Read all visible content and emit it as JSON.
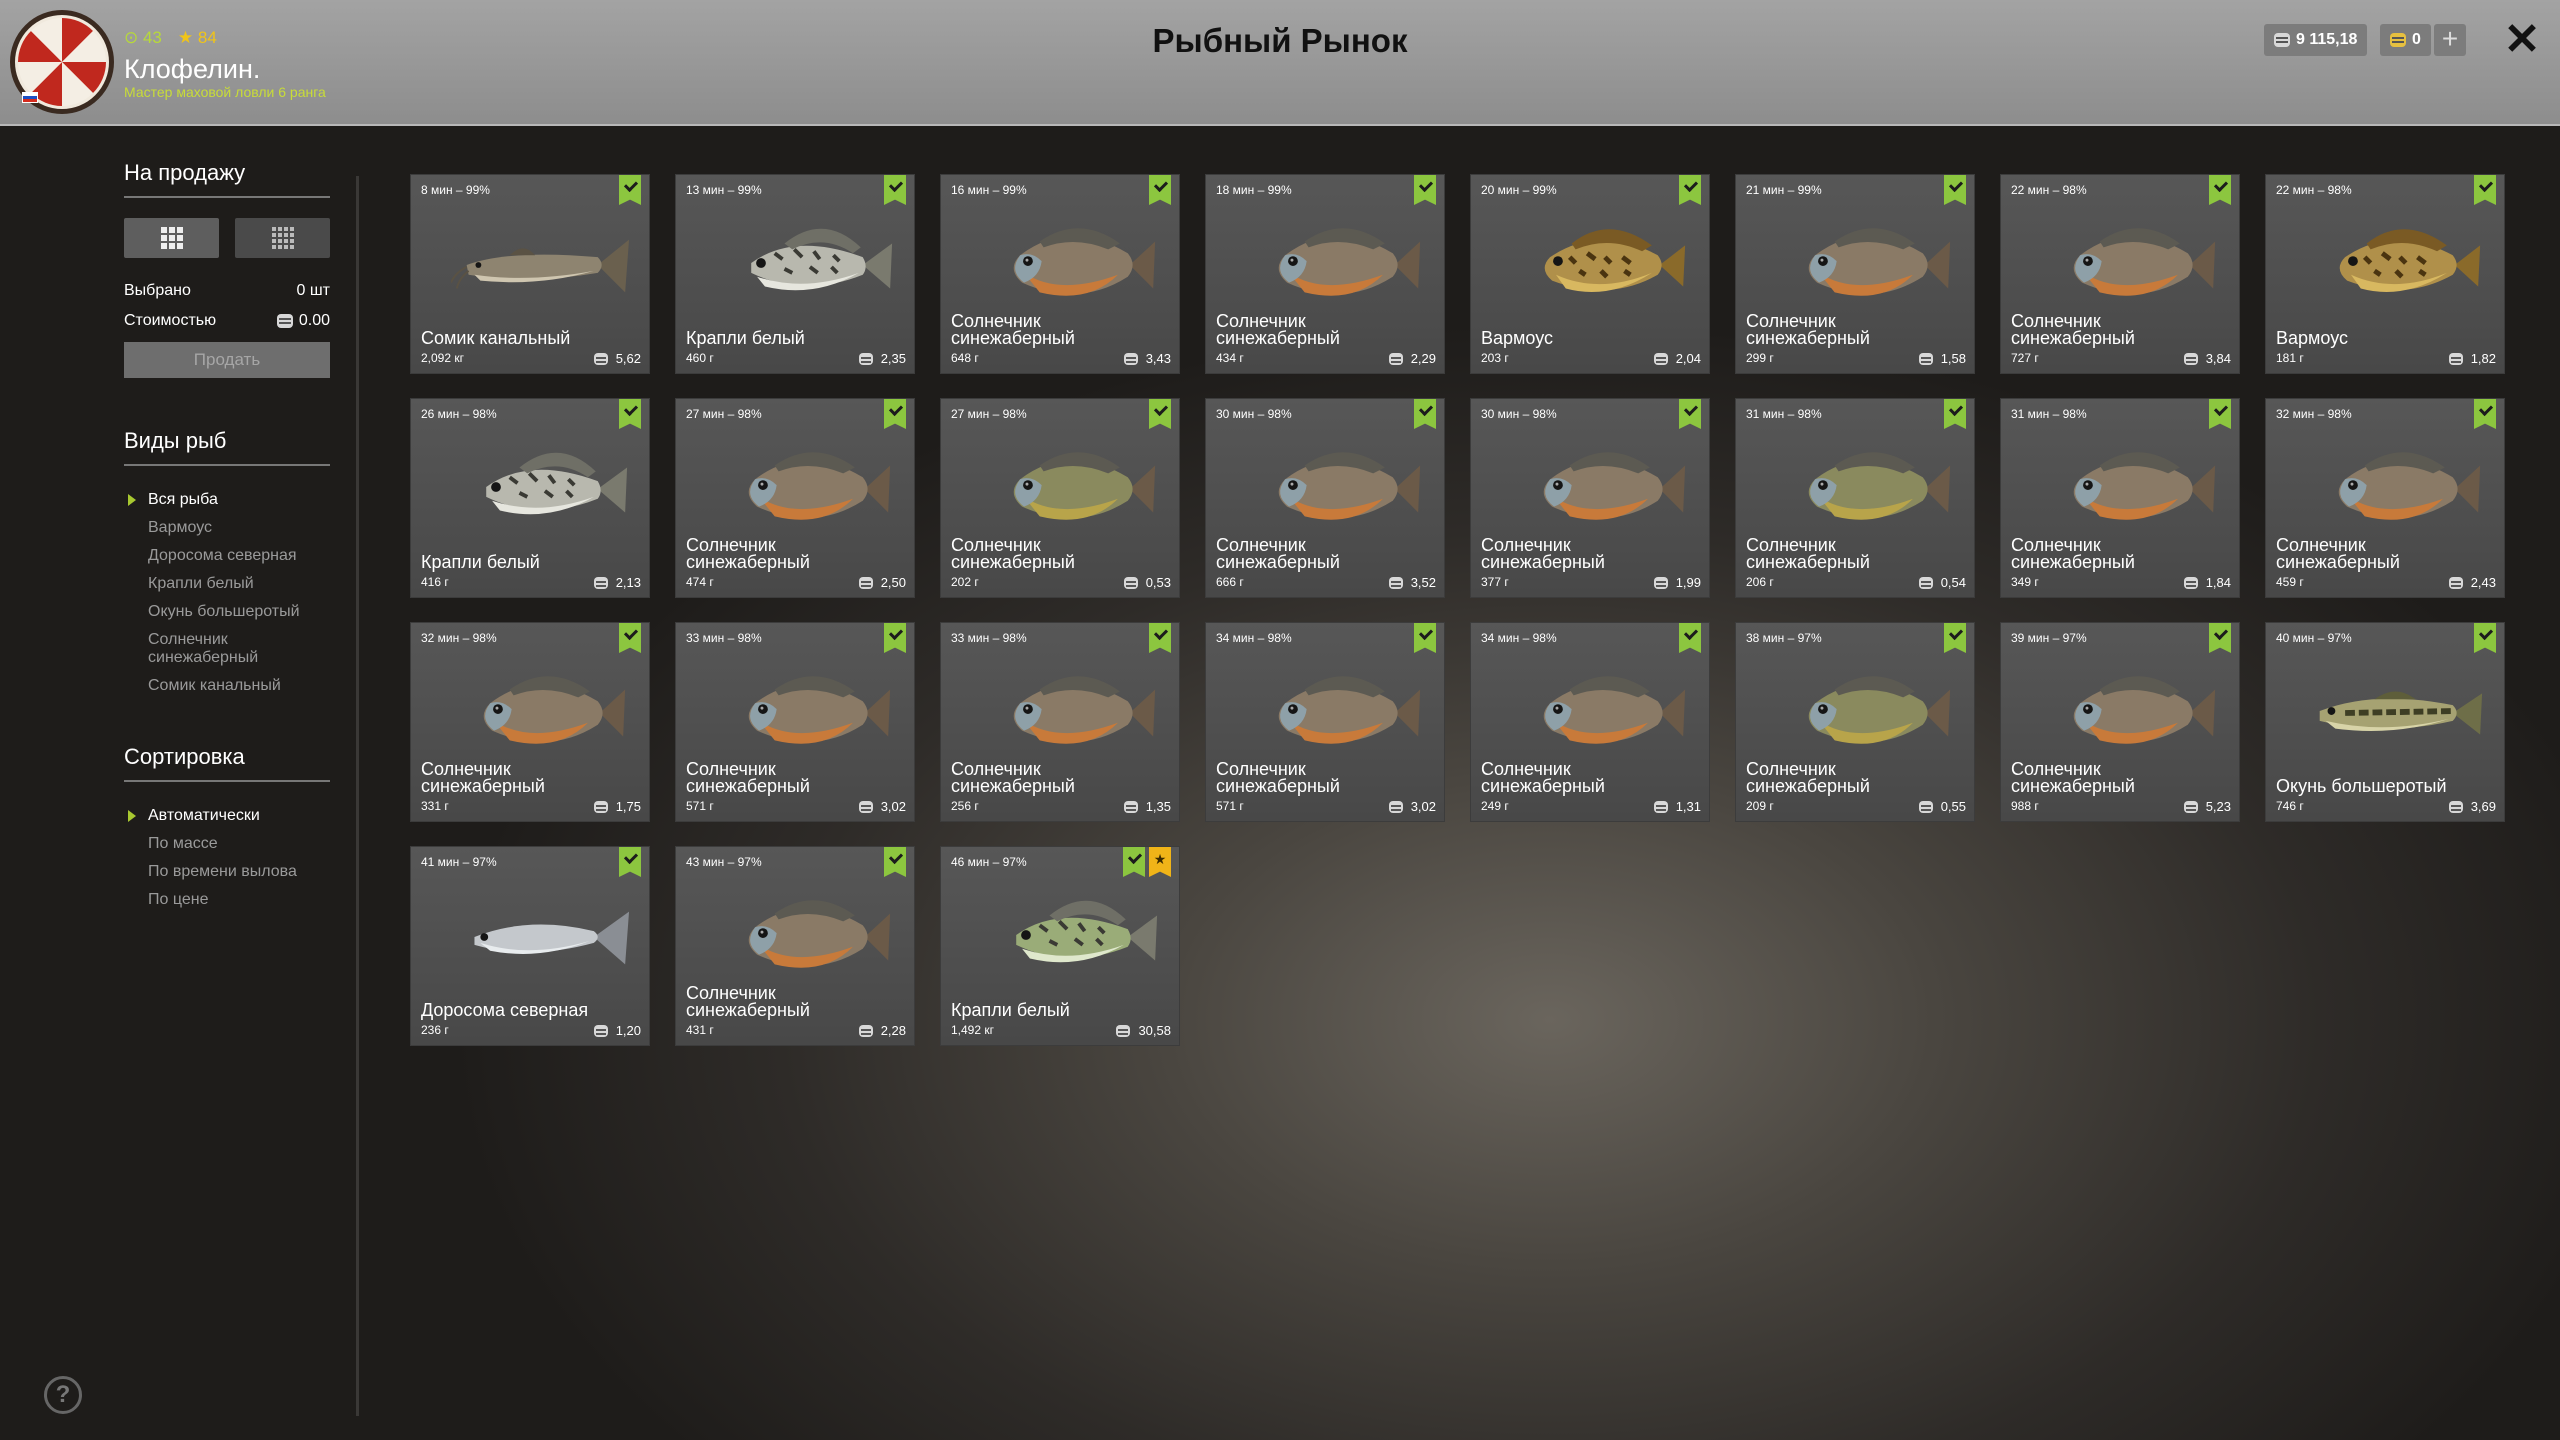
{
  "header": {
    "title": "Рыбный Рынок",
    "stat_a": "43",
    "stat_b": "84",
    "player_name": "Клофелин.",
    "player_rank": "Мастер маховой ловли 6 ранга",
    "silver": "9 115,18",
    "gold": "0",
    "add_label": "+",
    "close_label": "✕"
  },
  "sidebar": {
    "for_sale_title": "На продажу",
    "selected_label": "Выбрано",
    "selected_value": "0 шт",
    "cost_label": "Стоимостью",
    "cost_value": "0.00",
    "sell_label": "Продать",
    "fish_types_title": "Виды рыб",
    "fish_types": [
      "Вся рыба",
      "Вармоус",
      "Доросома северная",
      "Крапли белый",
      "Окунь большеротый",
      "Солнечник синежаберный",
      "Сомик канальный"
    ],
    "fish_types_active": 0,
    "sort_title": "Сортировка",
    "sort_options": [
      "Автоматически",
      "По массе",
      "По времени вылова",
      "По цене"
    ],
    "sort_active": 0
  },
  "help_label": "?",
  "colors": {
    "check": "#8cc63f",
    "star": "#f0b418",
    "rank": "#c8dc38"
  },
  "cards": [
    {
      "time": "8 мин – 99%",
      "name": "Сомик канальный",
      "weight": "2,092 кг",
      "price": "5,62",
      "fish": "catfish",
      "star": false
    },
    {
      "time": "13 мин – 99%",
      "name": "Крапли белый",
      "weight": "460 г",
      "price": "2,35",
      "fish": "crappie",
      "star": false
    },
    {
      "time": "16 мин – 99%",
      "name": "Солнечник синежаберный",
      "weight": "648 г",
      "price": "3,43",
      "fish": "bluegill",
      "star": false
    },
    {
      "time": "18 мин – 99%",
      "name": "Солнечник синежаберный",
      "weight": "434 г",
      "price": "2,29",
      "fish": "bluegill",
      "star": false
    },
    {
      "time": "20 мин – 99%",
      "name": "Вармоус",
      "weight": "203 г",
      "price": "2,04",
      "fish": "warmouth",
      "star": false
    },
    {
      "time": "21 мин – 99%",
      "name": "Солнечник синежаберный",
      "weight": "299 г",
      "price": "1,58",
      "fish": "bluegill",
      "star": false
    },
    {
      "time": "22 мин – 98%",
      "name": "Солнечник синежаберный",
      "weight": "727 г",
      "price": "3,84",
      "fish": "bluegill",
      "star": false
    },
    {
      "time": "22 мин – 98%",
      "name": "Вармоус",
      "weight": "181 г",
      "price": "1,82",
      "fish": "warmouth",
      "star": false
    },
    {
      "time": "26 мин – 98%",
      "name": "Крапли белый",
      "weight": "416 г",
      "price": "2,13",
      "fish": "crappie",
      "star": false
    },
    {
      "time": "27 мин – 98%",
      "name": "Солнечник синежаберный",
      "weight": "474 г",
      "price": "2,50",
      "fish": "bluegill",
      "star": false
    },
    {
      "time": "27 мин – 98%",
      "name": "Солнечник синежаберный",
      "weight": "202 г",
      "price": "0,53",
      "fish": "bluegill-green",
      "star": false
    },
    {
      "time": "30 мин – 98%",
      "name": "Солнечник синежаберный",
      "weight": "666 г",
      "price": "3,52",
      "fish": "bluegill",
      "star": false
    },
    {
      "time": "30 мин – 98%",
      "name": "Солнечник синежаберный",
      "weight": "377 г",
      "price": "1,99",
      "fish": "bluegill",
      "star": false
    },
    {
      "time": "31 мин – 98%",
      "name": "Солнечник синежаберный",
      "weight": "206 г",
      "price": "0,54",
      "fish": "bluegill-green",
      "star": false
    },
    {
      "time": "31 мин – 98%",
      "name": "Солнечник синежаберный",
      "weight": "349 г",
      "price": "1,84",
      "fish": "bluegill",
      "star": false
    },
    {
      "time": "32 мин – 98%",
      "name": "Солнечник синежаберный",
      "weight": "459 г",
      "price": "2,43",
      "fish": "bluegill",
      "star": false
    },
    {
      "time": "32 мин – 98%",
      "name": "Солнечник синежаберный",
      "weight": "331 г",
      "price": "1,75",
      "fish": "bluegill",
      "star": false
    },
    {
      "time": "33 мин – 98%",
      "name": "Солнечник синежаберный",
      "weight": "571 г",
      "price": "3,02",
      "fish": "bluegill",
      "star": false
    },
    {
      "time": "33 мин – 98%",
      "name": "Солнечник синежаберный",
      "weight": "256 г",
      "price": "1,35",
      "fish": "bluegill",
      "star": false
    },
    {
      "time": "34 мин – 98%",
      "name": "Солнечник синежаберный",
      "weight": "571 г",
      "price": "3,02",
      "fish": "bluegill",
      "star": false
    },
    {
      "time": "34 мин – 98%",
      "name": "Солнечник синежаберный",
      "weight": "249 г",
      "price": "1,31",
      "fish": "bluegill",
      "star": false
    },
    {
      "time": "38 мин – 97%",
      "name": "Солнечник синежаберный",
      "weight": "209 г",
      "price": "0,55",
      "fish": "bluegill-green",
      "star": false
    },
    {
      "time": "39 мин – 97%",
      "name": "Солнечник синежаберный",
      "weight": "988 г",
      "price": "5,23",
      "fish": "bluegill",
      "star": false
    },
    {
      "time": "40 мин – 97%",
      "name": "Окунь большеротый",
      "weight": "746 г",
      "price": "3,69",
      "fish": "bass",
      "star": false
    },
    {
      "time": "41 мин – 97%",
      "name": "Доросома северная",
      "weight": "236 г",
      "price": "1,20",
      "fish": "shad",
      "star": false
    },
    {
      "time": "43 мин – 97%",
      "name": "Солнечник синежаберный",
      "weight": "431 г",
      "price": "2,28",
      "fish": "bluegill",
      "star": false
    },
    {
      "time": "46 мин – 97%",
      "name": "Крапли белый",
      "weight": "1,492 кг",
      "price": "30,58",
      "fish": "crappie-green",
      "star": true
    }
  ]
}
